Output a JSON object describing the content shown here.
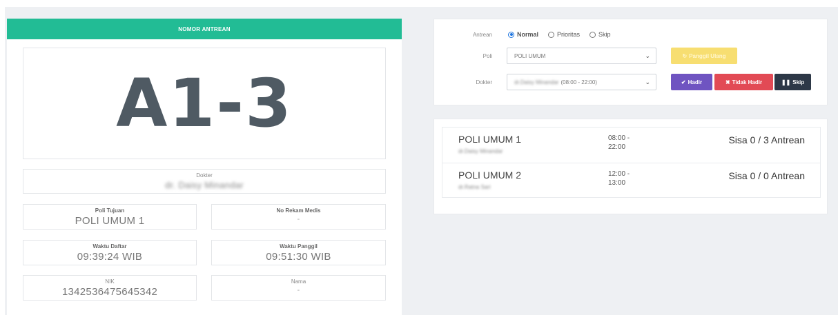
{
  "left": {
    "header": "NOMOR ANTREAN",
    "queue_number": "A1-3",
    "dokter_label": "Dokter",
    "dokter_value": "dr. Daisy Minandar",
    "poli_tujuan_label": "Poli Tujuan",
    "poli_tujuan_value": "POLI UMUM 1",
    "no_rm_label": "No Rekam Medis",
    "no_rm_value": "-",
    "waktu_daftar_label": "Waktu Daftar",
    "waktu_daftar_value": "09:39:24 WIB",
    "waktu_panggil_label": "Waktu Panggil",
    "waktu_panggil_value": "09:51:30 WIB",
    "nik_label": "NIK",
    "nik_value": "1342536475645342",
    "nama_label": "Nama",
    "nama_value": "-"
  },
  "form": {
    "antrean_label": "Antrean",
    "radios": {
      "normal": "Normal",
      "prioritas": "Prioritas",
      "skip": "Skip"
    },
    "selected_radio": "Normal",
    "poli_label": "Poli",
    "poli_value": "POLI UMUM",
    "dokter_label": "Dokter",
    "dokter_value": "dr.Daisy Minandar",
    "dokter_time": "(08:00 - 22:00)",
    "buttons": {
      "panggil_ulang": "Panggil Ulang",
      "hadir": "Hadir",
      "tidak_hadir": "Tidak Hadir",
      "skip": "Skip"
    }
  },
  "list": [
    {
      "poli": "POLI UMUM 1",
      "dokter": "dr.Daisy Minandar",
      "time_start": "08:00 -",
      "time_end": "22:00",
      "sisa": "Sisa 0 / 3 Antrean"
    },
    {
      "poli": "POLI UMUM 2",
      "dokter": "dr.Ratna Sari",
      "time_start": "12:00 -",
      "time_end": "13:00",
      "sisa": "Sisa 0 / 0 Antrean"
    }
  ],
  "colors": {
    "accent_green": "#22bc95",
    "purple": "#6f54c1",
    "red": "#e24a55",
    "dark": "#2d3847",
    "yellow": "#f7de71"
  },
  "icons": {
    "chevron": "chevron-down-icon",
    "check": "check-icon",
    "x_circle": "x-circle-icon",
    "pause": "pause-icon",
    "refresh": "refresh-icon"
  }
}
